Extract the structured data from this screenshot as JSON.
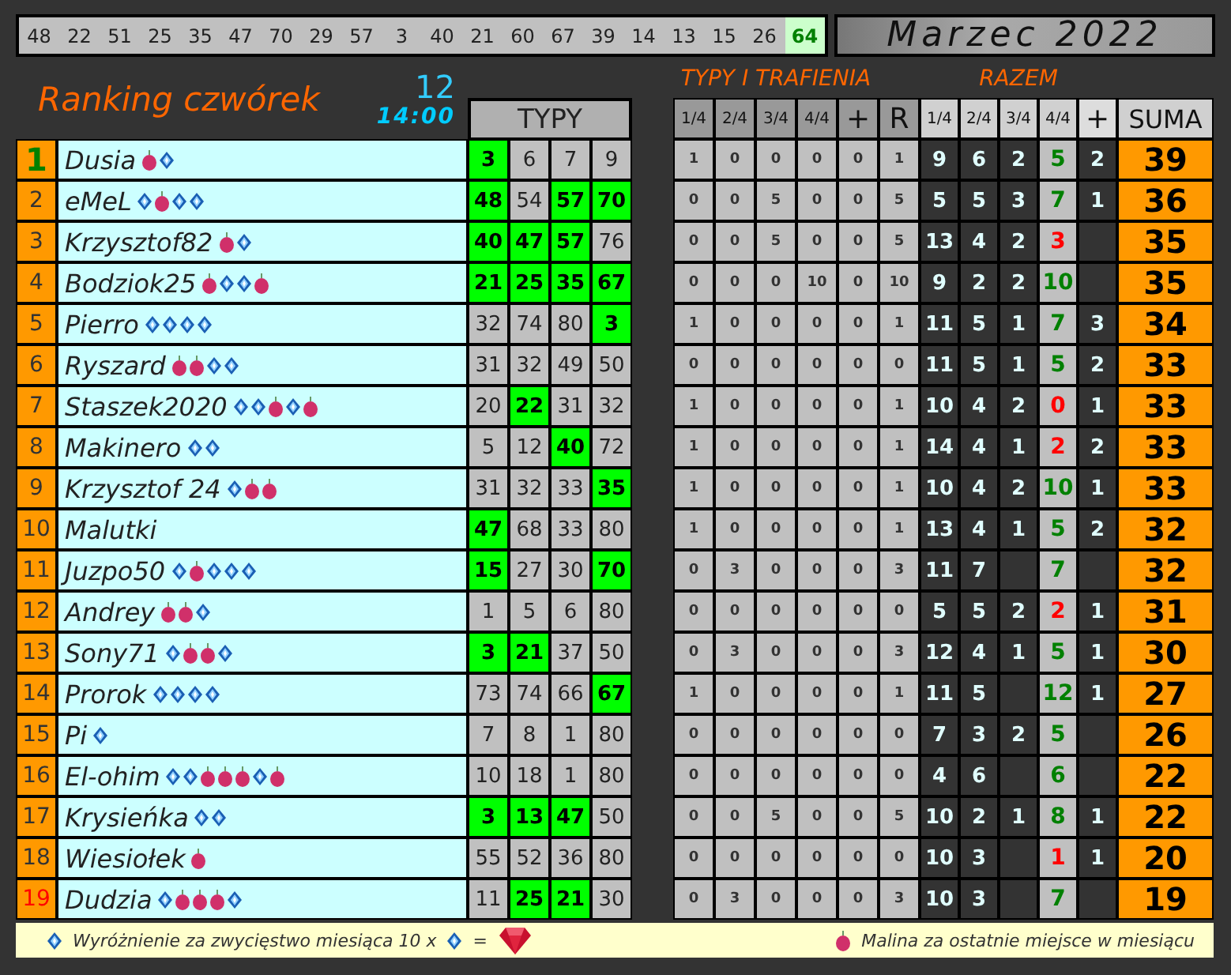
{
  "draw_bar": {
    "numbers": [
      {
        "value": "48",
        "highlighted": false
      },
      {
        "value": "22",
        "highlighted": false
      },
      {
        "value": "51",
        "highlighted": false
      },
      {
        "value": "25",
        "highlighted": false
      },
      {
        "value": "35",
        "highlighted": false
      },
      {
        "value": "47",
        "highlighted": false
      },
      {
        "value": "70",
        "highlighted": false
      },
      {
        "value": "29",
        "highlighted": false
      },
      {
        "value": "57",
        "highlighted": false
      },
      {
        "value": "3",
        "highlighted": false
      },
      {
        "value": "40",
        "highlighted": false
      },
      {
        "value": "21",
        "highlighted": false
      },
      {
        "value": "60",
        "highlighted": false
      },
      {
        "value": "67",
        "highlighted": false
      },
      {
        "value": "39",
        "highlighted": false
      },
      {
        "value": "14",
        "highlighted": false
      },
      {
        "value": "13",
        "highlighted": false
      },
      {
        "value": "15",
        "highlighted": false
      },
      {
        "value": "26",
        "highlighted": false
      },
      {
        "value": "64",
        "highlighted": true
      }
    ]
  },
  "month_title": "Marzec 2022",
  "title": "Ranking czwórek",
  "round": "12",
  "time": "14:00",
  "headers": {
    "typy": "TYPY",
    "trafienia_group": "TYPY I TRAFIENIA",
    "razem_group": "RAZEM",
    "trafienia": [
      "1/4",
      "2/4",
      "3/4",
      "4/4",
      "+",
      "R"
    ],
    "razem": [
      "1/4",
      "2/4",
      "3/4",
      "4/4",
      "+"
    ],
    "suma": "SUMA"
  },
  "rows": [
    {
      "rank": "1",
      "leader": true,
      "last": false,
      "name": "Dusia",
      "badges": [
        {
          "kind": "malina"
        },
        {
          "kind": "diamond"
        }
      ],
      "picks": [
        "3",
        "6",
        "7",
        "9"
      ],
      "hits": [
        true,
        false,
        false,
        false
      ],
      "trafienia": [
        "1",
        "0",
        "0",
        "0",
        "0",
        "1"
      ],
      "razem": {
        "r1": "9",
        "r2": "6",
        "r3": "2",
        "r4": "5",
        "plus": "2"
      },
      "full_low": false,
      "suma": "39"
    },
    {
      "rank": "2",
      "leader": false,
      "last": false,
      "name": "eMeL",
      "badges": [
        {
          "kind": "diamond"
        },
        {
          "kind": "malina"
        },
        {
          "kind": "diamond"
        },
        {
          "kind": "diamond"
        }
      ],
      "picks": [
        "48",
        "54",
        "57",
        "70"
      ],
      "hits": [
        true,
        false,
        true,
        true
      ],
      "trafienia": [
        "0",
        "0",
        "5",
        "0",
        "0",
        "5"
      ],
      "razem": {
        "r1": "5",
        "r2": "5",
        "r3": "3",
        "r4": "7",
        "plus": "1"
      },
      "full_low": false,
      "suma": "36"
    },
    {
      "rank": "3",
      "leader": false,
      "last": false,
      "name": "Krzysztof82",
      "badges": [
        {
          "kind": "malina"
        },
        {
          "kind": "diamond"
        }
      ],
      "picks": [
        "40",
        "47",
        "57",
        "76"
      ],
      "hits": [
        true,
        true,
        true,
        false
      ],
      "trafienia": [
        "0",
        "0",
        "5",
        "0",
        "0",
        "5"
      ],
      "razem": {
        "r1": "13",
        "r2": "4",
        "r3": "2",
        "r4": "3"
      },
      "full_low": true,
      "suma": "35"
    },
    {
      "rank": "4",
      "leader": false,
      "last": false,
      "name": "Bodziok25",
      "badges": [
        {
          "kind": "malina"
        },
        {
          "kind": "diamond"
        },
        {
          "kind": "diamond"
        },
        {
          "kind": "malina"
        }
      ],
      "picks": [
        "21",
        "25",
        "35",
        "67"
      ],
      "hits": [
        true,
        true,
        true,
        true
      ],
      "trafienia": [
        "0",
        "0",
        "0",
        "10",
        "0",
        "10"
      ],
      "razem": {
        "r1": "9",
        "r2": "2",
        "r3": "2",
        "r4": "10"
      },
      "full_low": false,
      "suma": "35"
    },
    {
      "rank": "5",
      "leader": false,
      "last": false,
      "name": "Pierro",
      "badges": [
        {
          "kind": "diamond"
        },
        {
          "kind": "diamond"
        },
        {
          "kind": "diamond"
        },
        {
          "kind": "diamond"
        }
      ],
      "picks": [
        "32",
        "74",
        "80",
        "3"
      ],
      "hits": [
        false,
        false,
        false,
        true
      ],
      "trafienia": [
        "1",
        "0",
        "0",
        "0",
        "0",
        "1"
      ],
      "razem": {
        "r1": "11",
        "r2": "5",
        "r3": "1",
        "r4": "7",
        "plus": "3"
      },
      "full_low": false,
      "suma": "34"
    },
    {
      "rank": "6",
      "leader": false,
      "last": false,
      "name": "Ryszard",
      "badges": [
        {
          "kind": "malina"
        },
        {
          "kind": "malina"
        },
        {
          "kind": "diamond"
        },
        {
          "kind": "diamond"
        }
      ],
      "picks": [
        "31",
        "32",
        "49",
        "50"
      ],
      "hits": [
        false,
        false,
        false,
        false
      ],
      "trafienia": [
        "0",
        "0",
        "0",
        "0",
        "0",
        "0"
      ],
      "razem": {
        "r1": "11",
        "r2": "5",
        "r3": "1",
        "r4": "5",
        "plus": "2"
      },
      "full_low": false,
      "suma": "33"
    },
    {
      "rank": "7",
      "leader": false,
      "last": false,
      "name": "Staszek2020",
      "badges": [
        {
          "kind": "diamond"
        },
        {
          "kind": "diamond"
        },
        {
          "kind": "malina"
        },
        {
          "kind": "diamond"
        },
        {
          "kind": "malina"
        }
      ],
      "picks": [
        "20",
        "22",
        "31",
        "32"
      ],
      "hits": [
        false,
        true,
        false,
        false
      ],
      "trafienia": [
        "1",
        "0",
        "0",
        "0",
        "0",
        "1"
      ],
      "razem": {
        "r1": "10",
        "r2": "4",
        "r3": "2",
        "r4": "0",
        "plus": "1"
      },
      "full_low": true,
      "suma": "33"
    },
    {
      "rank": "8",
      "leader": false,
      "last": false,
      "name": "Makinero",
      "badges": [
        {
          "kind": "diamond"
        },
        {
          "kind": "diamond"
        }
      ],
      "picks": [
        "5",
        "12",
        "40",
        "72"
      ],
      "hits": [
        false,
        false,
        true,
        false
      ],
      "trafienia": [
        "1",
        "0",
        "0",
        "0",
        "0",
        "1"
      ],
      "razem": {
        "r1": "14",
        "r2": "4",
        "r3": "1",
        "r4": "2",
        "plus": "2"
      },
      "full_low": true,
      "suma": "33"
    },
    {
      "rank": "9",
      "leader": false,
      "last": false,
      "name": "Krzysztof 24",
      "badges": [
        {
          "kind": "diamond"
        },
        {
          "kind": "malina"
        },
        {
          "kind": "malina"
        }
      ],
      "picks": [
        "31",
        "32",
        "33",
        "35"
      ],
      "hits": [
        false,
        false,
        false,
        true
      ],
      "trafienia": [
        "1",
        "0",
        "0",
        "0",
        "0",
        "1"
      ],
      "razem": {
        "r1": "10",
        "r2": "4",
        "r3": "2",
        "r4": "10",
        "plus": "1"
      },
      "full_low": false,
      "suma": "33"
    },
    {
      "rank": "10",
      "leader": false,
      "last": false,
      "name": "Malutki",
      "badges": [],
      "picks": [
        "47",
        "68",
        "33",
        "80"
      ],
      "hits": [
        true,
        false,
        false,
        false
      ],
      "trafienia": [
        "1",
        "0",
        "0",
        "0",
        "0",
        "1"
      ],
      "razem": {
        "r1": "13",
        "r2": "4",
        "r3": "1",
        "r4": "5",
        "plus": "2"
      },
      "full_low": false,
      "suma": "32"
    },
    {
      "rank": "11",
      "leader": false,
      "last": false,
      "name": "Juzpo50",
      "badges": [
        {
          "kind": "diamond"
        },
        {
          "kind": "malina"
        },
        {
          "kind": "diamond"
        },
        {
          "kind": "diamond"
        },
        {
          "kind": "diamond"
        }
      ],
      "picks": [
        "15",
        "27",
        "30",
        "70"
      ],
      "hits": [
        true,
        false,
        false,
        true
      ],
      "trafienia": [
        "0",
        "3",
        "0",
        "0",
        "0",
        "3"
      ],
      "razem": {
        "r1": "11",
        "r2": "7",
        "r4": "7"
      },
      "full_low": false,
      "suma": "32"
    },
    {
      "rank": "12",
      "leader": false,
      "last": false,
      "name": "Andrey",
      "badges": [
        {
          "kind": "malina"
        },
        {
          "kind": "malina"
        },
        {
          "kind": "diamond"
        }
      ],
      "picks": [
        "1",
        "5",
        "6",
        "80"
      ],
      "hits": [
        false,
        false,
        false,
        false
      ],
      "trafienia": [
        "0",
        "0",
        "0",
        "0",
        "0",
        "0"
      ],
      "razem": {
        "r1": "5",
        "r2": "5",
        "r3": "2",
        "r4": "2",
        "plus": "1"
      },
      "full_low": true,
      "suma": "31"
    },
    {
      "rank": "13",
      "leader": false,
      "last": false,
      "name": "Sony71",
      "badges": [
        {
          "kind": "diamond"
        },
        {
          "kind": "malina"
        },
        {
          "kind": "malina"
        },
        {
          "kind": "diamond"
        }
      ],
      "picks": [
        "3",
        "21",
        "37",
        "50"
      ],
      "hits": [
        true,
        true,
        false,
        false
      ],
      "trafienia": [
        "0",
        "3",
        "0",
        "0",
        "0",
        "3"
      ],
      "razem": {
        "r1": "12",
        "r2": "4",
        "r3": "1",
        "r4": "5",
        "plus": "1"
      },
      "full_low": false,
      "suma": "30"
    },
    {
      "rank": "14",
      "leader": false,
      "last": false,
      "name": "Prorok",
      "badges": [
        {
          "kind": "diamond"
        },
        {
          "kind": "diamond"
        },
        {
          "kind": "diamond"
        },
        {
          "kind": "diamond"
        }
      ],
      "picks": [
        "73",
        "74",
        "66",
        "67"
      ],
      "hits": [
        false,
        false,
        false,
        true
      ],
      "trafienia": [
        "1",
        "0",
        "0",
        "0",
        "0",
        "1"
      ],
      "razem": {
        "r1": "11",
        "r2": "5",
        "r4": "12",
        "plus": "1"
      },
      "full_low": false,
      "suma": "27"
    },
    {
      "rank": "15",
      "leader": false,
      "last": false,
      "name": "Pi",
      "badges": [
        {
          "kind": "diamond"
        }
      ],
      "picks": [
        "7",
        "8",
        "1",
        "80"
      ],
      "hits": [
        false,
        false,
        false,
        false
      ],
      "trafienia": [
        "0",
        "0",
        "0",
        "0",
        "0",
        "0"
      ],
      "razem": {
        "r1": "7",
        "r2": "3",
        "r3": "2",
        "r4": "5"
      },
      "full_low": false,
      "suma": "26"
    },
    {
      "rank": "16",
      "leader": false,
      "last": false,
      "name": "El-ohim",
      "badges": [
        {
          "kind": "diamond"
        },
        {
          "kind": "diamond"
        },
        {
          "kind": "malina"
        },
        {
          "kind": "malina"
        },
        {
          "kind": "malina"
        },
        {
          "kind": "diamond"
        },
        {
          "kind": "malina"
        }
      ],
      "picks": [
        "10",
        "18",
        "1",
        "80"
      ],
      "hits": [
        false,
        false,
        false,
        false
      ],
      "trafienia": [
        "0",
        "0",
        "0",
        "0",
        "0",
        "0"
      ],
      "razem": {
        "r1": "4",
        "r2": "6",
        "r4": "6"
      },
      "full_low": false,
      "suma": "22"
    },
    {
      "rank": "17",
      "leader": false,
      "last": false,
      "name": "Krysieńka",
      "badges": [
        {
          "kind": "diamond"
        },
        {
          "kind": "diamond"
        }
      ],
      "picks": [
        "3",
        "13",
        "47",
        "50"
      ],
      "hits": [
        true,
        true,
        true,
        false
      ],
      "trafienia": [
        "0",
        "0",
        "5",
        "0",
        "0",
        "5"
      ],
      "razem": {
        "r1": "10",
        "r2": "2",
        "r3": "1",
        "r4": "8",
        "plus": "1"
      },
      "full_low": false,
      "suma": "22"
    },
    {
      "rank": "18",
      "leader": false,
      "last": false,
      "name": "Wiesiołek",
      "badges": [
        {
          "kind": "malina"
        }
      ],
      "picks": [
        "55",
        "52",
        "36",
        "80"
      ],
      "hits": [
        false,
        false,
        false,
        false
      ],
      "trafienia": [
        "0",
        "0",
        "0",
        "0",
        "0",
        "0"
      ],
      "razem": {
        "r1": "10",
        "r2": "3",
        "r4": "1",
        "plus": "1"
      },
      "full_low": true,
      "suma": "20"
    },
    {
      "rank": "19",
      "leader": false,
      "last": true,
      "name": "Dudzia",
      "badges": [
        {
          "kind": "diamond"
        },
        {
          "kind": "malina"
        },
        {
          "kind": "malina"
        },
        {
          "kind": "malina"
        },
        {
          "kind": "diamond"
        }
      ],
      "picks": [
        "11",
        "25",
        "21",
        "30"
      ],
      "hits": [
        false,
        true,
        true,
        false
      ],
      "trafienia": [
        "0",
        "3",
        "0",
        "0",
        "0",
        "3"
      ],
      "razem": {
        "r1": "10",
        "r2": "3",
        "r4": "7"
      },
      "full_low": false,
      "suma": "19"
    }
  ],
  "legend": {
    "winner_text": "Wyróżnienie za zwycięstwo miesiąca 10 x",
    "equals": "=",
    "malina_text": "Malina za ostatnie miejsce w miesiącu"
  }
}
